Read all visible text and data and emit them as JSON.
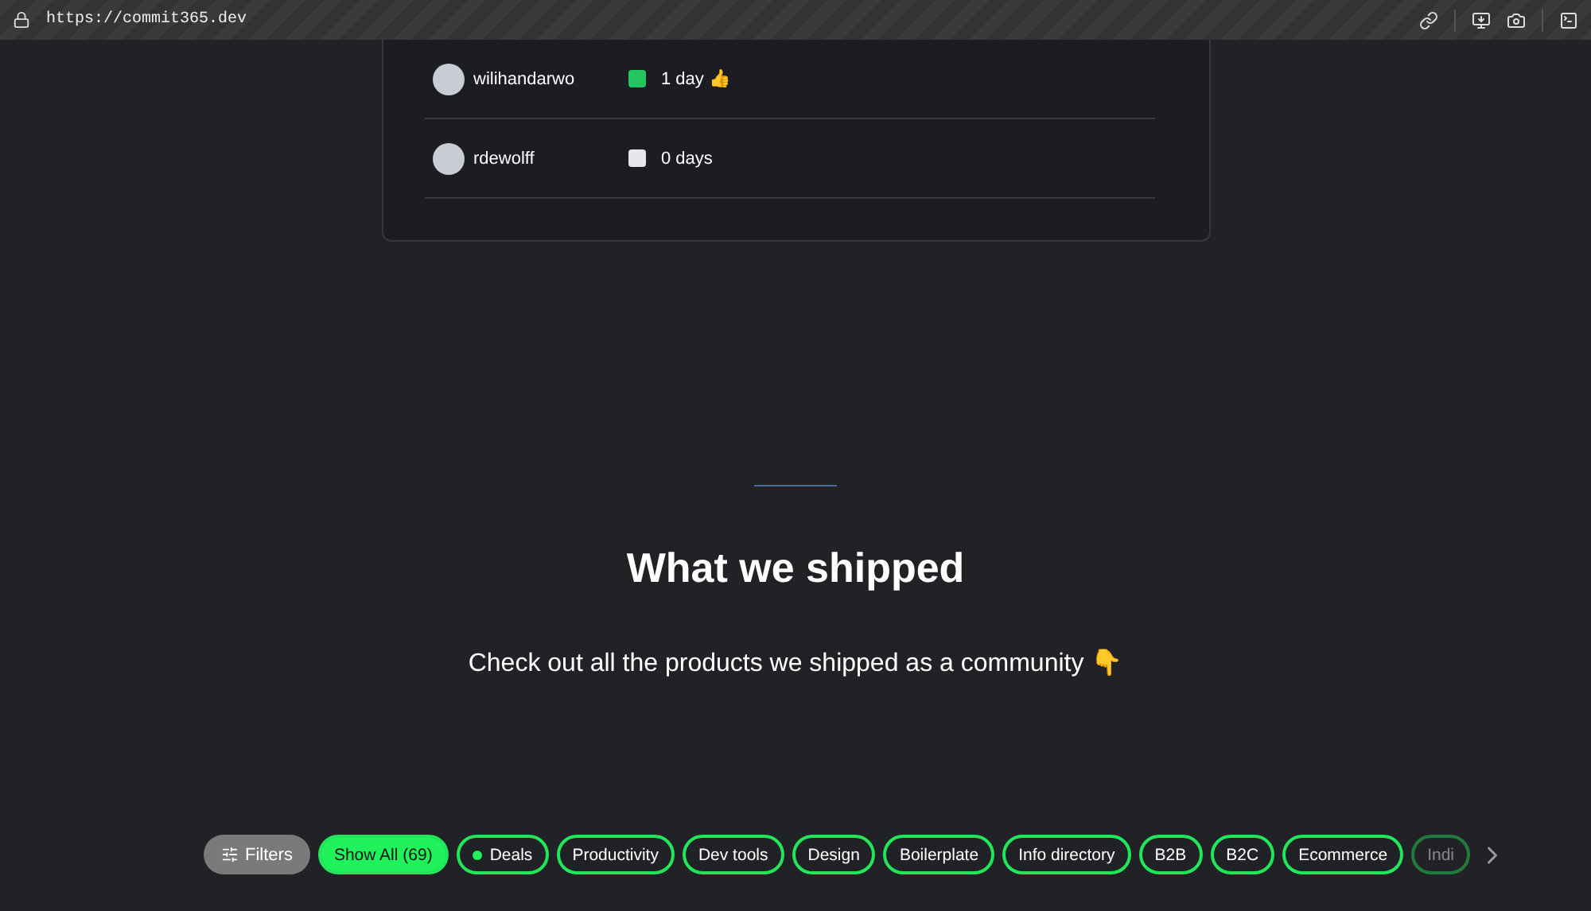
{
  "browser_bar": {
    "url": "https://commit365.dev"
  },
  "streaks": [
    {
      "user": "wilihandarwo",
      "active": true,
      "streak": "1 day 👍"
    },
    {
      "user": "rdewolff",
      "active": false,
      "streak": "0 days"
    }
  ],
  "section": {
    "title": "What we shipped",
    "subtitle": "Check out all the products we shipped as a community 👇"
  },
  "filters_button": "Filters",
  "chips": [
    {
      "label": "Show All (69)",
      "selected": true,
      "kind": "plain"
    },
    {
      "label": "Deals",
      "selected": false,
      "kind": "dot"
    },
    {
      "label": "Productivity",
      "selected": false,
      "kind": "plain"
    },
    {
      "label": "Dev tools",
      "selected": false,
      "kind": "plain"
    },
    {
      "label": "Design",
      "selected": false,
      "kind": "plain"
    },
    {
      "label": "Boilerplate",
      "selected": false,
      "kind": "plain"
    },
    {
      "label": "Info directory",
      "selected": false,
      "kind": "plain"
    },
    {
      "label": "B2B",
      "selected": false,
      "kind": "plain"
    },
    {
      "label": "B2C",
      "selected": false,
      "kind": "plain"
    },
    {
      "label": "Ecommerce",
      "selected": false,
      "kind": "plain"
    },
    {
      "label": "Indi",
      "selected": false,
      "kind": "faded"
    }
  ]
}
